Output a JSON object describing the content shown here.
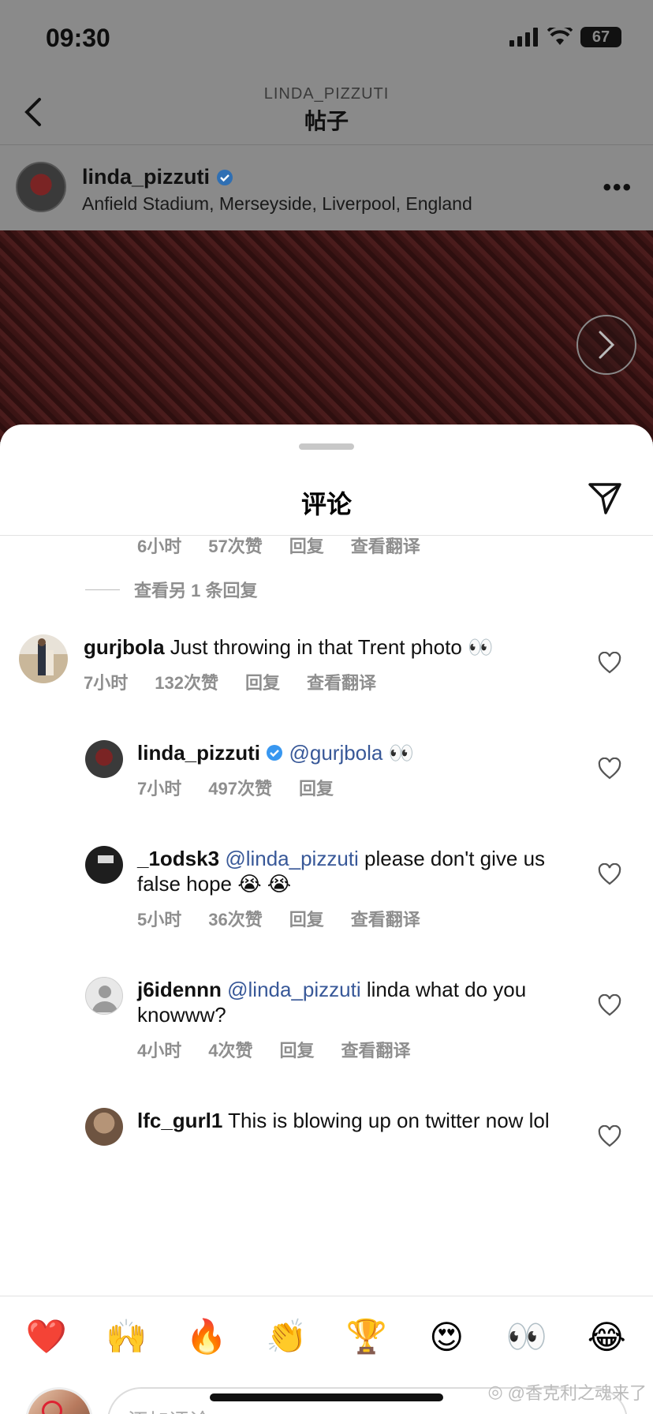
{
  "status_bar": {
    "time": "09:30",
    "battery": "67",
    "icons": [
      "signal-icon",
      "wifi-icon",
      "battery-icon"
    ]
  },
  "nav": {
    "subtitle": "LINDA_PIZZUTI",
    "title": "帖子"
  },
  "post": {
    "username": "linda_pizzuti",
    "verified": true,
    "location": "Anfield Stadium, Merseyside, Liverpool, England",
    "more_icon": "more-horizontal-icon"
  },
  "sheet": {
    "title": "评论",
    "share_icon": "send-icon"
  },
  "partial_meta": {
    "time": "6小时",
    "likes": "57次赞",
    "reply": "回复",
    "translate": "查看翻译"
  },
  "view_more_replies": "查看另 1 条回复",
  "comments": [
    {
      "username": "gurjbola",
      "text": "Just throwing in that Trent photo 👀",
      "time": "7小时",
      "likes": "132次赞",
      "reply": "回复",
      "translate": "查看翻译"
    },
    {
      "username": "linda_pizzuti",
      "verified": true,
      "mention": "@gurjbola",
      "text": "👀",
      "time": "7小时",
      "likes": "497次赞",
      "reply": "回复"
    },
    {
      "username": "_1odsk3",
      "mention": "@linda_pizzuti",
      "text": "please don't give us false hope 😭 😭",
      "time": "5小时",
      "likes": "36次赞",
      "reply": "回复",
      "translate": "查看翻译"
    },
    {
      "username": "j6idennn",
      "mention": "@linda_pizzuti",
      "text": "linda what do you knowww?",
      "time": "4小时",
      "likes": "4次赞",
      "reply": "回复",
      "translate": "查看翻译"
    },
    {
      "username": "lfc_gurl1",
      "text": "This is blowing up on twitter now lol"
    }
  ],
  "emoji_bar": [
    "❤️",
    "🙌",
    "🔥",
    "👏",
    "🏆",
    "😍",
    "👀",
    "😂"
  ],
  "input": {
    "placeholder": "添加评论..."
  },
  "watermark": "@香克利之魂来了",
  "colors": {
    "mention": "#385898",
    "verified": "#3897f0",
    "meta": "#8e8e8e"
  }
}
